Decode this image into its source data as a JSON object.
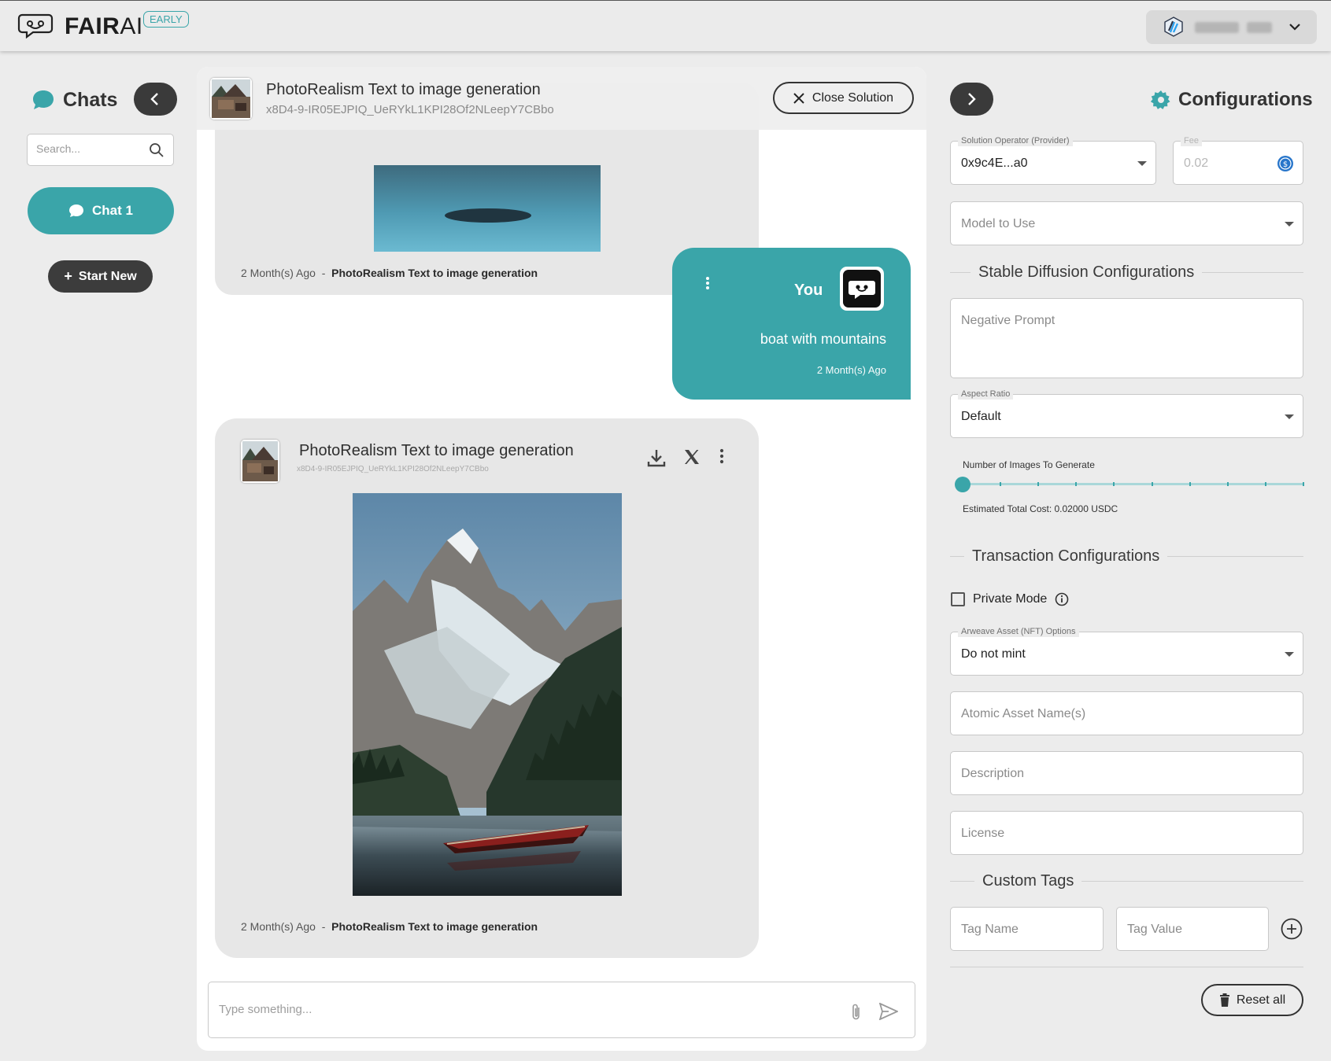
{
  "app": {
    "logo_bold": "FAIR",
    "logo_thin": "AI",
    "badge": "EARLY"
  },
  "sidebar": {
    "title": "Chats",
    "search_placeholder": "Search...",
    "chats": [
      {
        "label": "Chat 1",
        "active": true
      }
    ],
    "start_new_label": "Start New"
  },
  "solution": {
    "title": "PhotoRealism Text to image generation",
    "id": "x8D4-9-IR05EJPIQ_UeRYkL1KPI28Of2NLeepY7CBbo",
    "close_label": "Close Solution"
  },
  "messages": [
    {
      "role": "assistant",
      "time": "2 Month(s) Ago",
      "separator": "-",
      "solution": "PhotoRealism Text to image generation"
    },
    {
      "role": "user",
      "author": "You",
      "text": "boat with mountains",
      "time": "2 Month(s) Ago"
    },
    {
      "role": "assistant",
      "title": "PhotoRealism Text to image generation",
      "id": "x8D4-9-IR05EJPIQ_UeRYkL1KPI28Of2NLeepY7CBbo",
      "time": "2 Month(s) Ago",
      "separator": "-",
      "solution": "PhotoRealism Text to image generation",
      "image_subject": "mountain lake with red boat"
    }
  ],
  "composer": {
    "placeholder": "Type something..."
  },
  "config": {
    "title": "Configurations",
    "operator": {
      "label": "Solution Operator (Provider)",
      "value": "0x9c4E...a0"
    },
    "fee": {
      "label": "Fee",
      "placeholder": "0.02"
    },
    "model_placeholder": "Model to Use",
    "sd_section": "Stable Diffusion Configurations",
    "negative_prompt_placeholder": "Negative Prompt",
    "aspect_ratio": {
      "label": "Aspect Ratio",
      "value": "Default"
    },
    "num_images_label": "Number of Images To Generate",
    "num_images_value": 1,
    "num_images_max": 10,
    "estimated_cost": "Estimated Total Cost: 0.02000 USDC",
    "tx_section": "Transaction Configurations",
    "private_mode_label": "Private Mode",
    "private_mode_checked": false,
    "arweave": {
      "label": "Arweave Asset (NFT) Options",
      "value": "Do not mint"
    },
    "asset_name_placeholder": "Atomic Asset Name(s)",
    "description_placeholder": "Description",
    "license_placeholder": "License",
    "custom_tags_section": "Custom Tags",
    "tag_name_placeholder": "Tag Name",
    "tag_value_placeholder": "Tag Value",
    "reset_label": "Reset all"
  },
  "colors": {
    "accent": "#3aa5a9",
    "dark_button": "#3a3a3a",
    "background": "#ececec"
  }
}
